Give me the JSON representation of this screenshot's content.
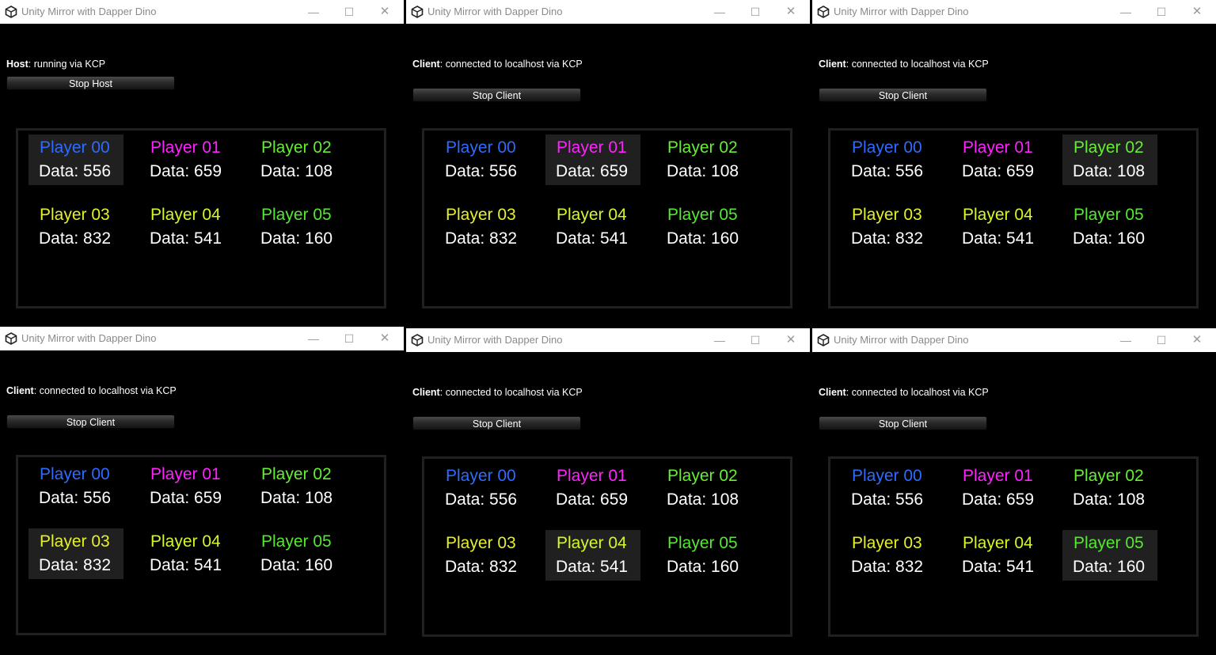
{
  "windows": [
    {
      "title": "Unity Mirror with Dapper Dino",
      "role": "Host",
      "status": "running via KCP",
      "button": "Stop Host",
      "selected": 0
    },
    {
      "title": "Unity Mirror with Dapper Dino",
      "role": "Client",
      "status": "connected to localhost via KCP",
      "button": "Stop Client",
      "selected": 1
    },
    {
      "title": "Unity Mirror with Dapper Dino",
      "role": "Client",
      "status": "connected to localhost via KCP",
      "button": "Stop Client",
      "selected": 2
    },
    {
      "title": "Unity Mirror with Dapper Dino",
      "role": "Client",
      "status": "connected to localhost via KCP",
      "button": "Stop Client",
      "selected": 3
    },
    {
      "title": "Unity Mirror with Dapper Dino",
      "role": "Client",
      "status": "connected to localhost via KCP",
      "button": "Stop Client",
      "selected": 4
    },
    {
      "title": "Unity Mirror with Dapper Dino",
      "role": "Client",
      "status": "connected to localhost via KCP",
      "button": "Stop Client",
      "selected": 5
    }
  ],
  "players": [
    {
      "name": "Player 00",
      "data": "Data: 556",
      "color": "#2f6bff"
    },
    {
      "name": "Player 01",
      "data": "Data: 659",
      "color": "#ff22ff"
    },
    {
      "name": "Player 02",
      "data": "Data: 108",
      "color": "#66ee33"
    },
    {
      "name": "Player 03",
      "data": "Data: 832",
      "color": "#e6f02a"
    },
    {
      "name": "Player 04",
      "data": "Data: 541",
      "color": "#d2f82a"
    },
    {
      "name": "Player 05",
      "data": "Data: 160",
      "color": "#55e833"
    }
  ],
  "window_controls": {
    "minimize": "—",
    "maximize": "☐",
    "close": "✕"
  }
}
